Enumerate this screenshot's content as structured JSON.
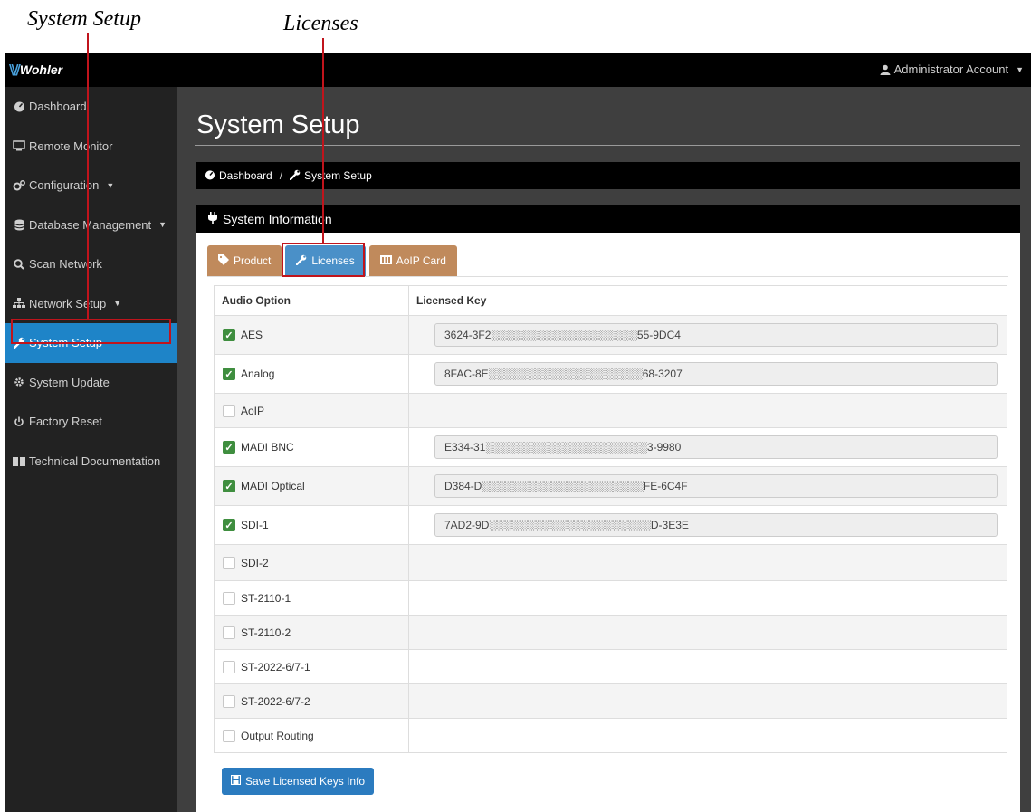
{
  "callouts": {
    "system_setup": "System Setup",
    "licenses": "Licenses"
  },
  "app": {
    "logo_text": "Wohler",
    "account_label": "Administrator Account",
    "colors": {
      "accent": "#1e84c8",
      "tab_inactive": "#c08a5c",
      "tab_active": "#4a90c8",
      "check": "#3f8e3f",
      "callout": "#c0141c"
    }
  },
  "sidebar": {
    "items": [
      {
        "label": "Dashboard",
        "icon": "dashboard-icon"
      },
      {
        "label": "Remote Monitor",
        "icon": "monitor-icon"
      },
      {
        "label": "Configuration",
        "icon": "cogs-icon",
        "caret": true
      },
      {
        "label": "Database Management",
        "icon": "database-icon",
        "caret": true
      },
      {
        "label": "Scan Network",
        "icon": "search-icon"
      },
      {
        "label": "Network Setup",
        "icon": "sitemap-icon",
        "caret": true
      },
      {
        "label": "System Setup",
        "icon": "wrench-icon",
        "active": true
      },
      {
        "label": "System Update",
        "icon": "gear-icon"
      },
      {
        "label": "Factory Reset",
        "icon": "power-icon"
      },
      {
        "label": "Technical Documentation",
        "icon": "book-icon"
      }
    ]
  },
  "main": {
    "title": "System Setup",
    "breadcrumb": {
      "home": "Dashboard",
      "separator": "/",
      "current": "System Setup"
    },
    "panel_title": "System Information",
    "tabs": [
      {
        "label": "Product",
        "icon": "tag-icon"
      },
      {
        "label": "Licenses",
        "icon": "wrench-icon",
        "active": true
      },
      {
        "label": "AoIP Card",
        "icon": "card-icon"
      }
    ],
    "table": {
      "headers": [
        "Audio Option",
        "Licensed Key"
      ],
      "rows": [
        {
          "option": "AES",
          "checked": true,
          "key": "3624-3F2░░░░░░░░░░░░░░░░░░░55-9DC4"
        },
        {
          "option": "Analog",
          "checked": true,
          "key": "8FAC-8E░░░░░░░░░░░░░░░░░░░░68-3207"
        },
        {
          "option": "AoIP",
          "checked": false,
          "key": ""
        },
        {
          "option": "MADI BNC",
          "checked": true,
          "key": "E334-31░░░░░░░░░░░░░░░░░░░░░3-9980"
        },
        {
          "option": "MADI Optical",
          "checked": true,
          "key": "D384-D░░░░░░░░░░░░░░░░░░░░░FE-6C4F"
        },
        {
          "option": "SDI-1",
          "checked": true,
          "key": "7AD2-9D░░░░░░░░░░░░░░░░░░░░░D-3E3E"
        },
        {
          "option": "SDI-2",
          "checked": false,
          "key": ""
        },
        {
          "option": "ST-2110-1",
          "checked": false,
          "key": ""
        },
        {
          "option": "ST-2110-2",
          "checked": false,
          "key": ""
        },
        {
          "option": "ST-2022-6/7-1",
          "checked": false,
          "key": ""
        },
        {
          "option": "ST-2022-6/7-2",
          "checked": false,
          "key": ""
        },
        {
          "option": "Output Routing",
          "checked": false,
          "key": ""
        }
      ]
    },
    "save_button": "Save Licensed Keys Info"
  }
}
